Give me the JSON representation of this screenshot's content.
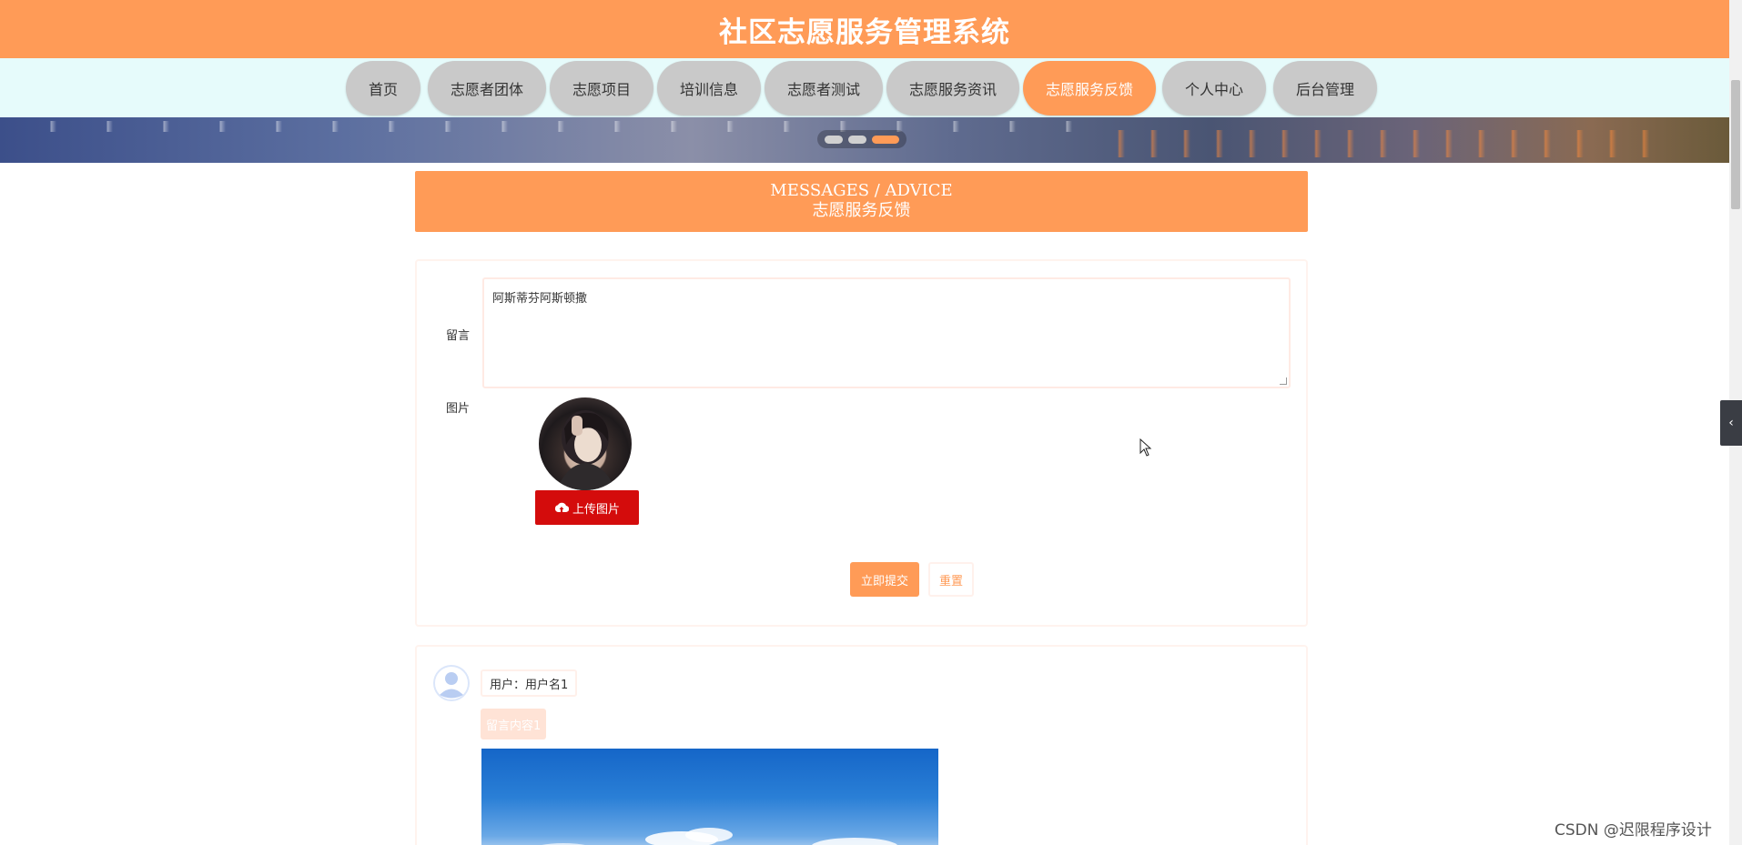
{
  "header": {
    "title": "社区志愿服务管理系统"
  },
  "nav": {
    "items": [
      {
        "label": "首页",
        "active": false
      },
      {
        "label": "志愿者团体",
        "active": false
      },
      {
        "label": "志愿项目",
        "active": false
      },
      {
        "label": "培训信息",
        "active": false
      },
      {
        "label": "志愿者测试",
        "active": false
      },
      {
        "label": "志愿服务资讯",
        "active": false
      },
      {
        "label": "志愿服务反馈",
        "active": true
      },
      {
        "label": "个人中心",
        "active": false
      },
      {
        "label": "后台管理",
        "active": false
      }
    ]
  },
  "banner": {
    "slide_count": 3,
    "active_slide": 3
  },
  "section": {
    "title_en": "MESSAGES / ADVICE",
    "title_cn": "志愿服务反馈"
  },
  "form": {
    "message_label": "留言",
    "message_value": "阿斯蒂芬阿斯顿撒",
    "image_label": "图片",
    "upload_label": "上传图片",
    "upload_icon": "cloud-upload-icon",
    "submit_label": "立即提交",
    "reset_label": "重置"
  },
  "messages": [
    {
      "user_text": "用户：用户名1",
      "content": "留言内容1"
    }
  ],
  "side_tab": {
    "icon": "chevron-left-icon",
    "glyph": "‹"
  },
  "watermark": "CSDN @迟限程序设计",
  "colors": {
    "accent": "#ff9b57",
    "upload": "#d40c0c",
    "nav_bg": "#e6fbfb"
  }
}
